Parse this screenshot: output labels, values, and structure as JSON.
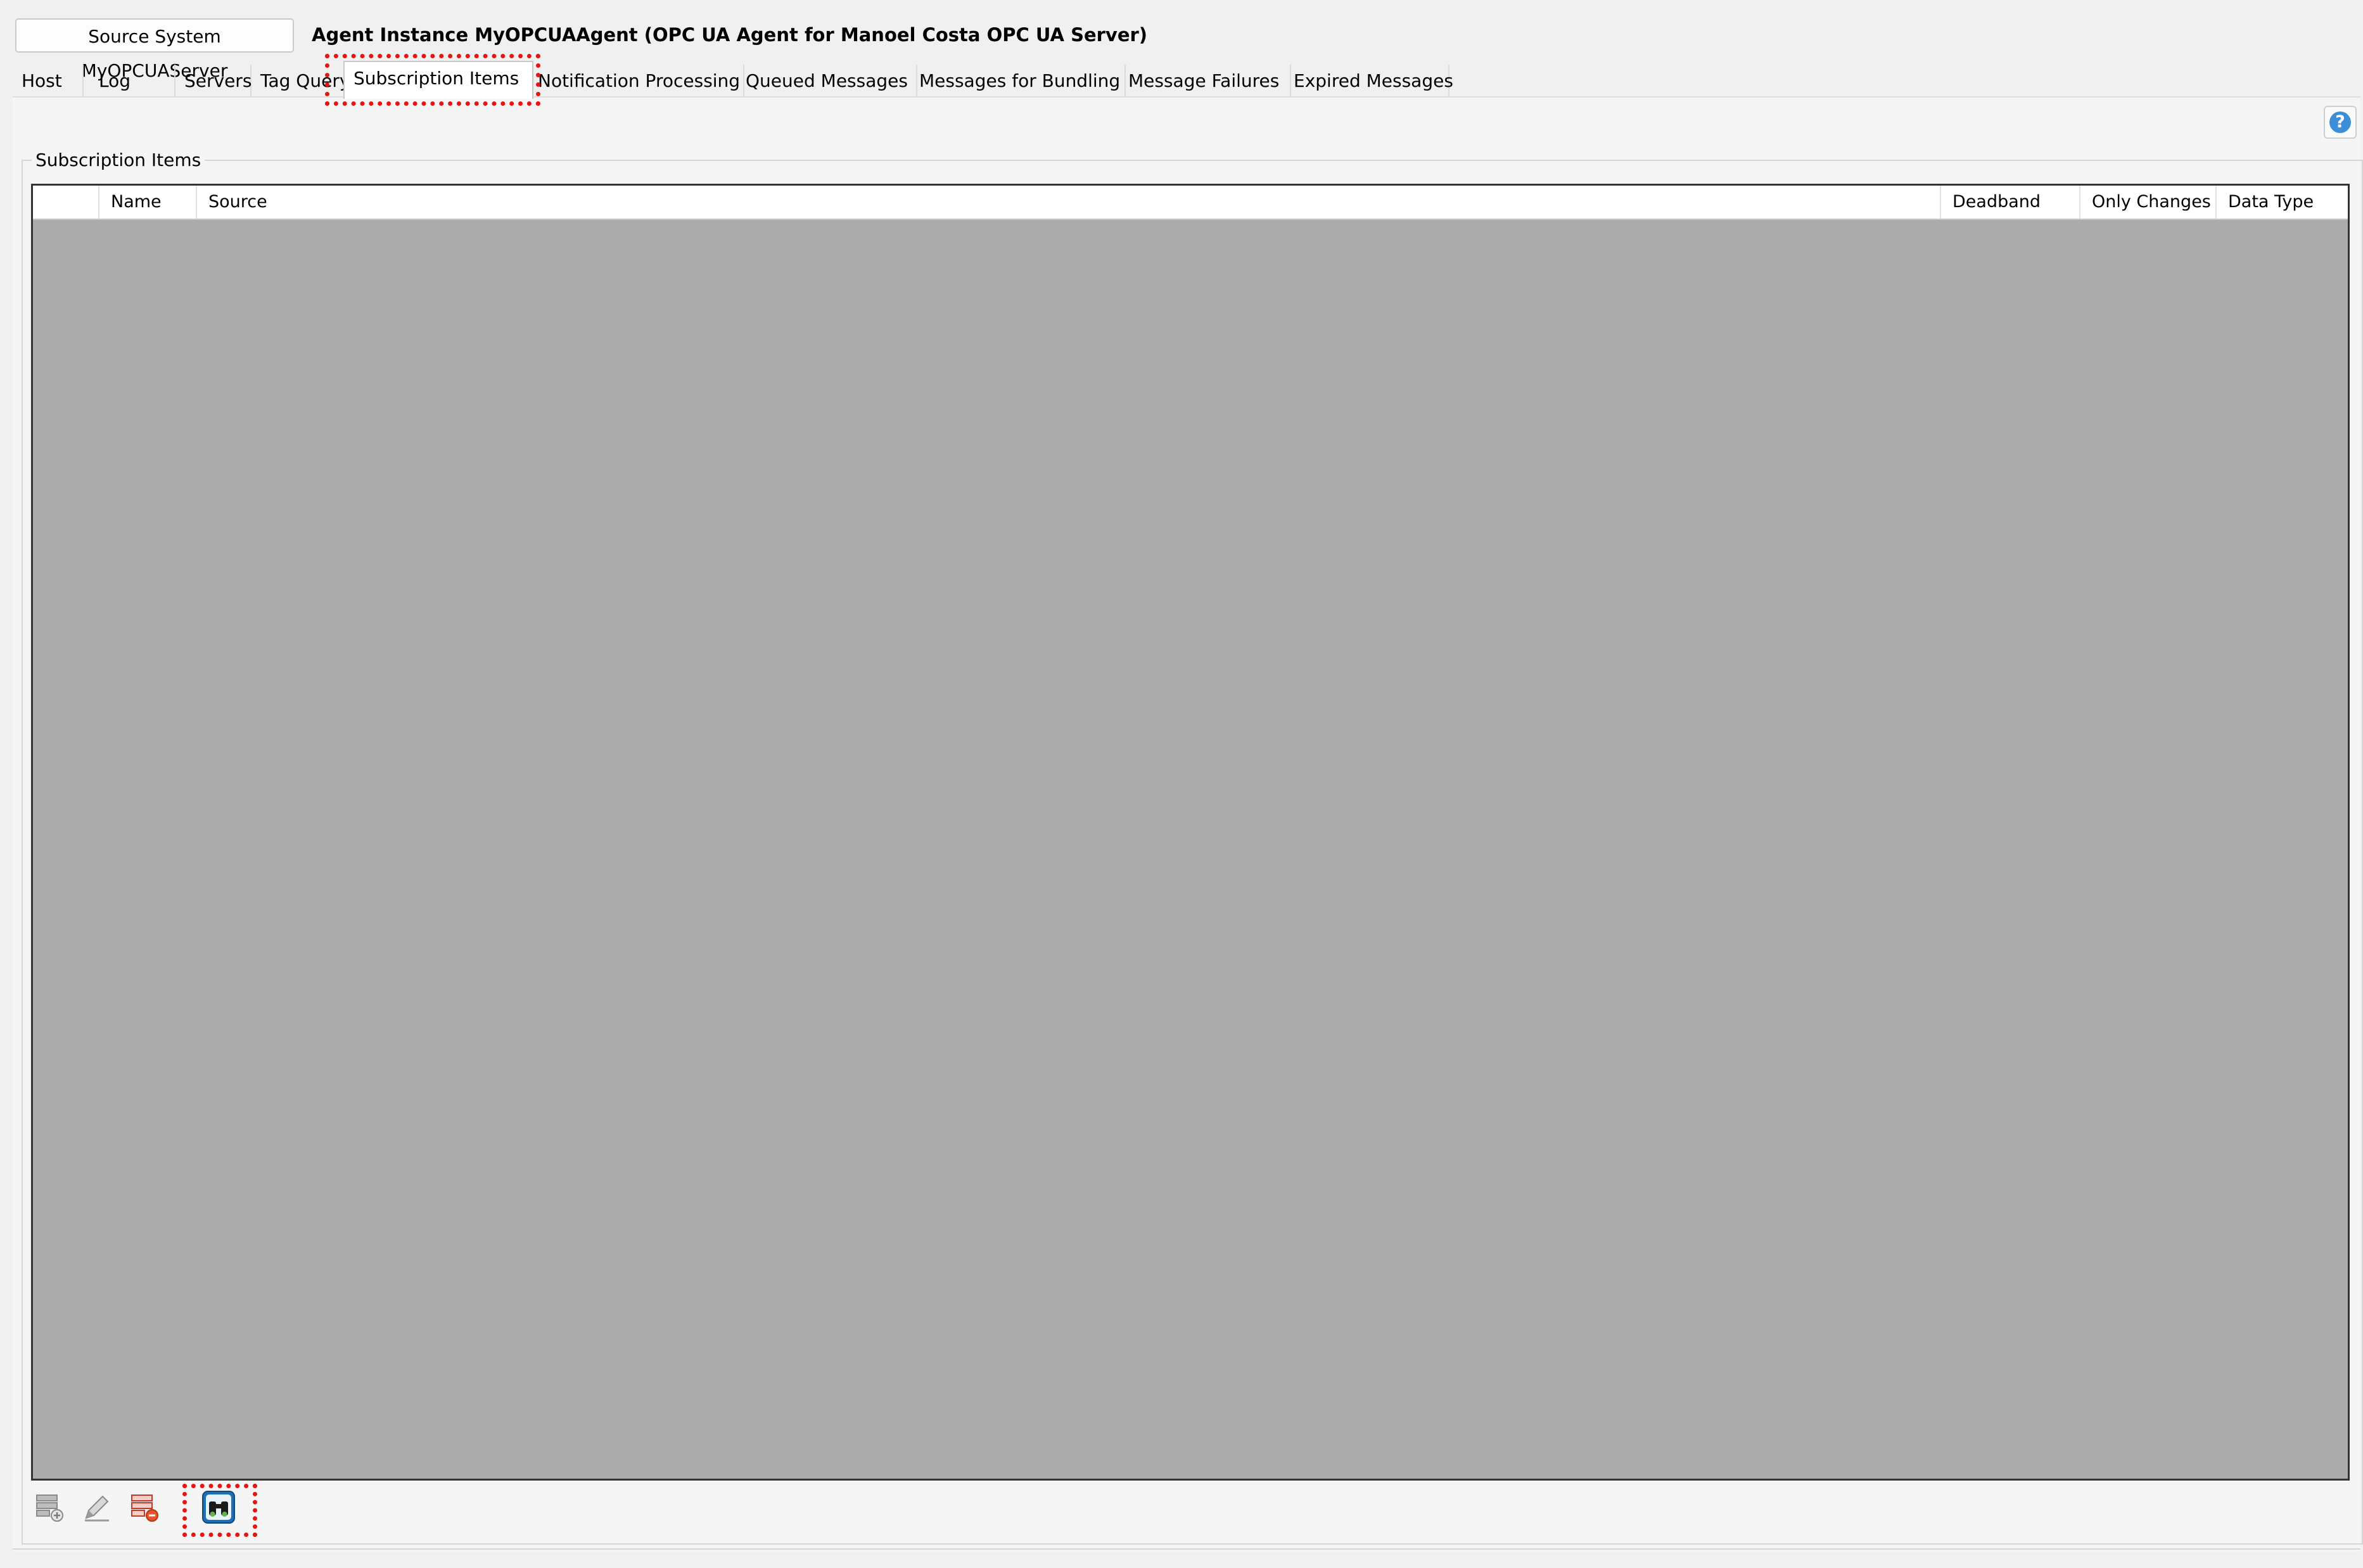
{
  "header": {
    "source_button": "Source System MyOPCUAServer",
    "agent_title": "Agent Instance MyOPCUAAgent (OPC UA Agent for Manoel Costa OPC UA Server)"
  },
  "tabs": [
    {
      "label": "Host"
    },
    {
      "label": "Log"
    },
    {
      "label": "Servers"
    },
    {
      "label": "Tag Query"
    },
    {
      "label": "Subscription Items"
    },
    {
      "label": "Notification Processing"
    },
    {
      "label": "Queued Messages"
    },
    {
      "label": "Messages for Bundling"
    },
    {
      "label": "Message Failures"
    },
    {
      "label": "Expired Messages"
    }
  ],
  "active_tab": "Subscription Items",
  "group": {
    "title": "Subscription Items"
  },
  "grid": {
    "columns": [
      "",
      "Name",
      "Source",
      "Deadband",
      "Only Changes",
      "Data Type"
    ],
    "rows": []
  },
  "toolbar": {
    "icons": [
      "add-row-icon",
      "edit-row-icon",
      "delete-row-icon",
      "browse-binoculars-icon"
    ]
  },
  "help": {
    "label": "?"
  },
  "colors": {
    "highlight": "#e81414",
    "grid_background": "#ababab",
    "help_icon": "#3d8ed8"
  }
}
